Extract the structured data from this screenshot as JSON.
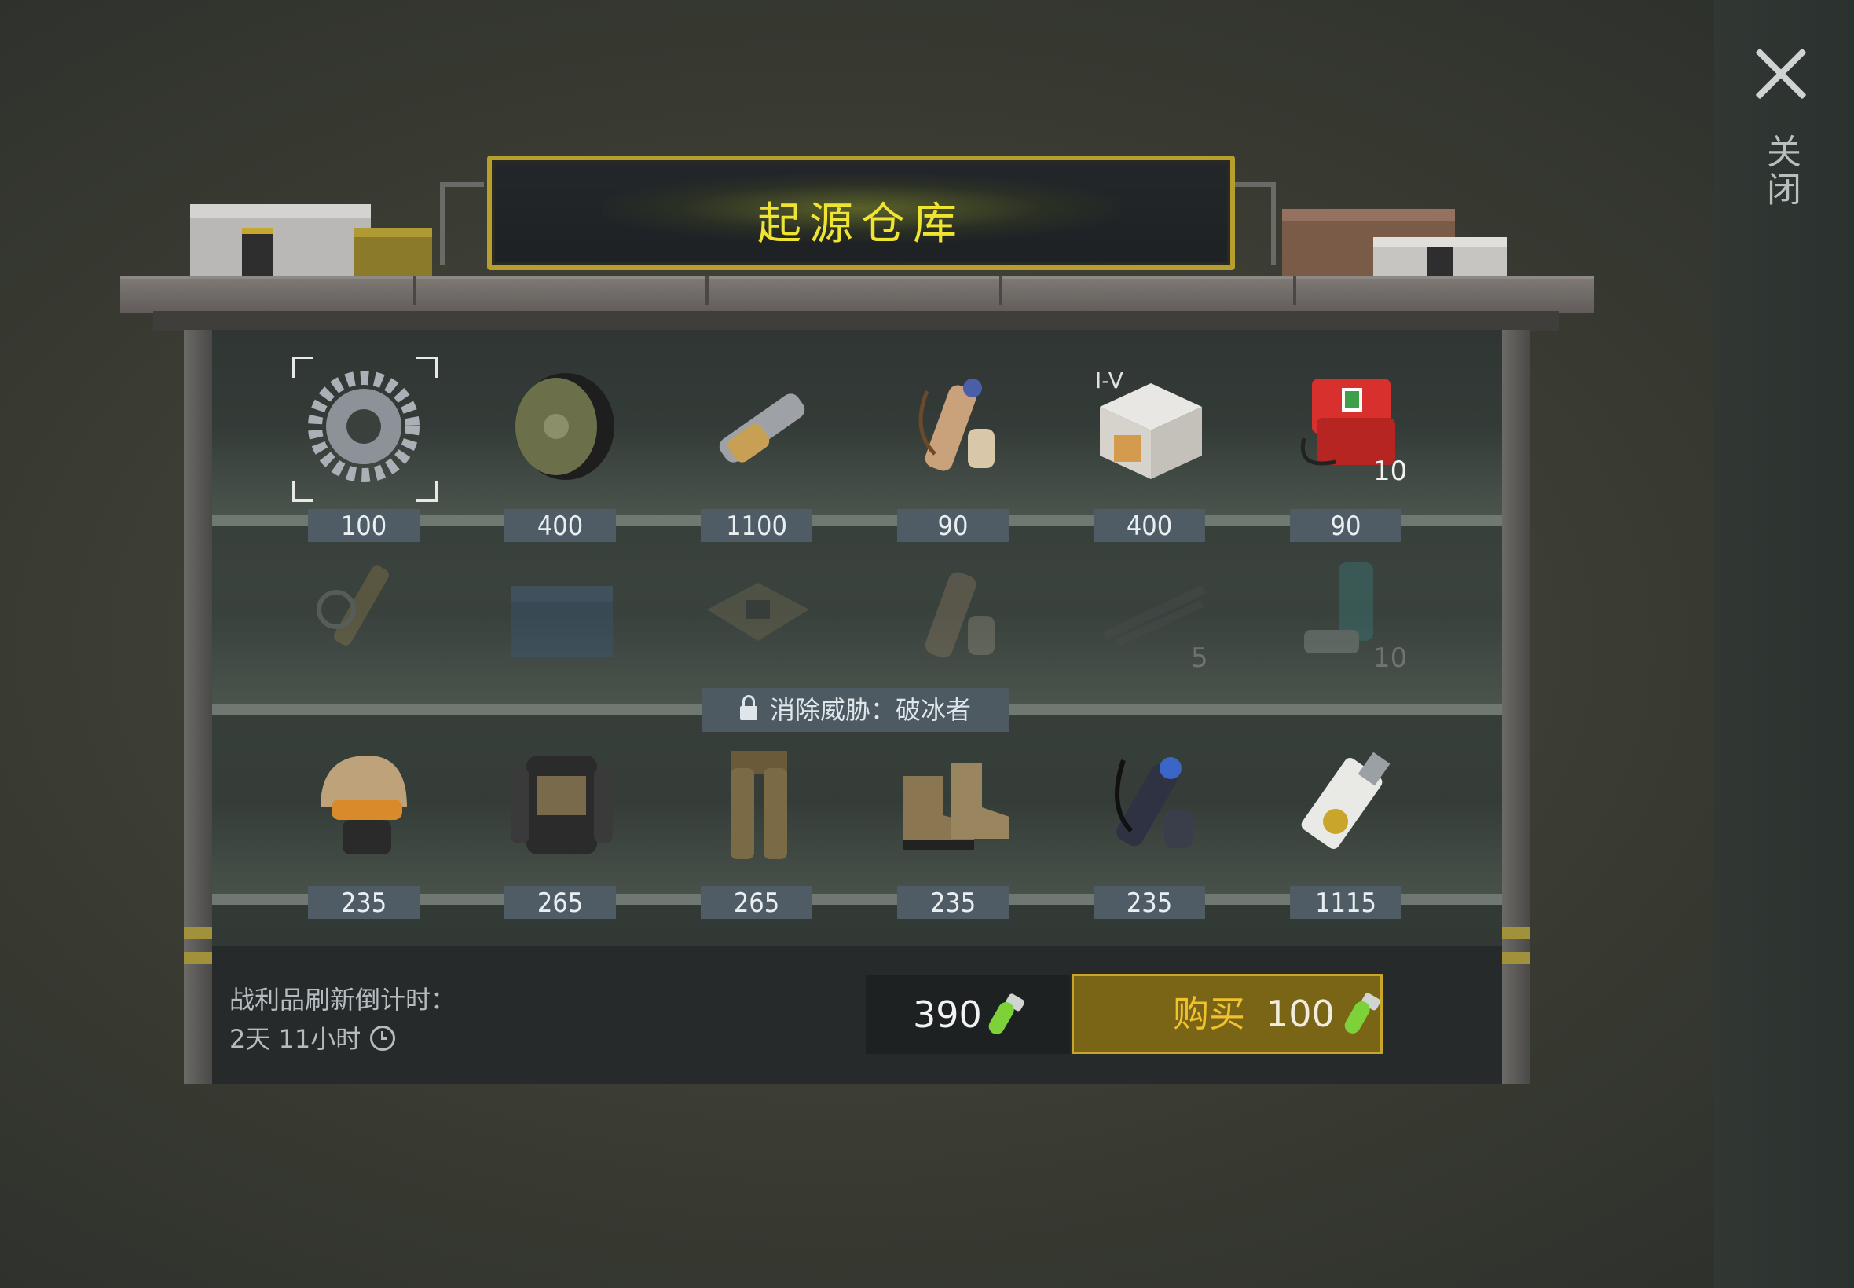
{
  "title": "起源仓库",
  "close": {
    "label": "关闭"
  },
  "shelf_row1": [
    {
      "icon": "gear-icon",
      "price": "100"
    },
    {
      "icon": "wheel-icon",
      "price": "400"
    },
    {
      "icon": "spring-mechanism-icon",
      "price": "1100"
    },
    {
      "icon": "bundle-icon",
      "price": "90"
    },
    {
      "icon": "crate-icon",
      "price": "400",
      "tier": "I-V"
    },
    {
      "icon": "first-aid-kit-icon",
      "price": "90",
      "qty": "10"
    }
  ],
  "shelf_row2_locked": [
    {
      "icon": "hydraulic-parts-icon"
    },
    {
      "icon": "battery-icon"
    },
    {
      "icon": "circuit-board-icon"
    },
    {
      "icon": "bundle-icon"
    },
    {
      "icon": "rods-icon",
      "qty": "5"
    },
    {
      "icon": "inhaler-icon",
      "qty": "10"
    }
  ],
  "lock_banner": "消除威胁：破冰者",
  "shelf_row3": [
    {
      "icon": "helmet-icon",
      "price": "235"
    },
    {
      "icon": "armor-vest-icon",
      "price": "265"
    },
    {
      "icon": "armor-pants-icon",
      "price": "265"
    },
    {
      "icon": "boots-icon",
      "price": "235"
    },
    {
      "icon": "scope-bundle-icon",
      "price": "235"
    },
    {
      "icon": "keycard-icon",
      "price": "1115"
    }
  ],
  "timer": {
    "label": "战利品刷新倒计时：",
    "value": "2天 11小时"
  },
  "balance": "390",
  "buy": {
    "label": "购买",
    "price": "100"
  },
  "colors": {
    "accent": "#c9a52a",
    "title": "#f0e432",
    "vial": "#7dd23a"
  }
}
